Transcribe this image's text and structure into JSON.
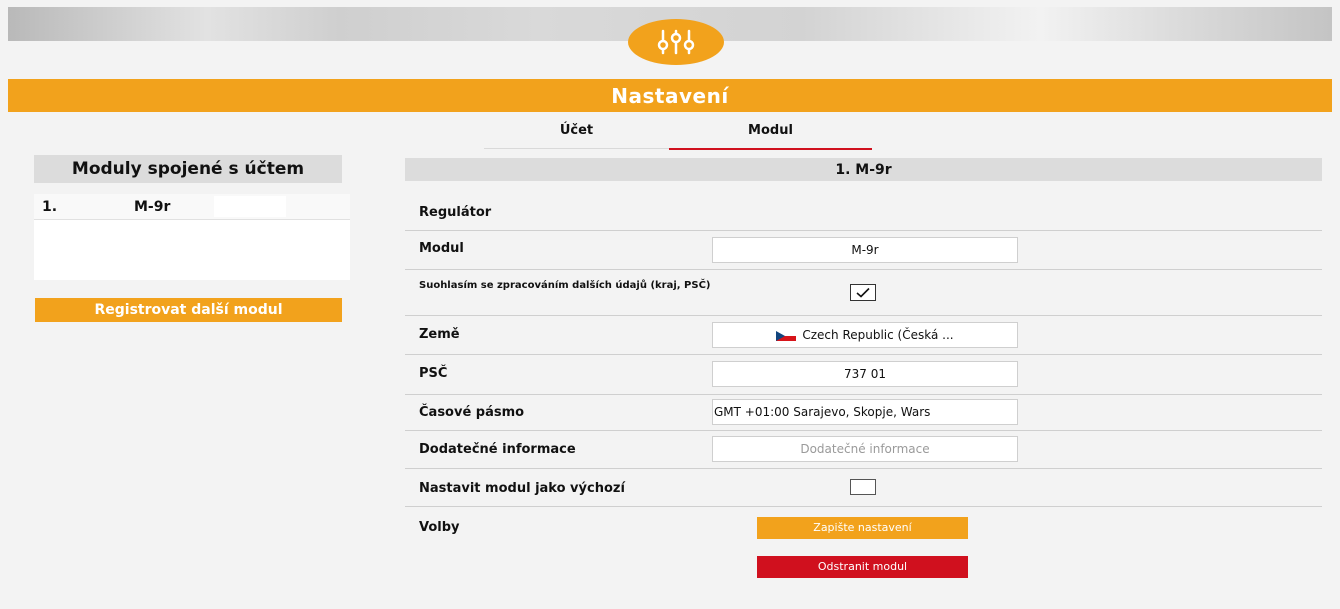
{
  "header": {
    "title": "Nastavení",
    "logo_icon": "settings-sliders-icon"
  },
  "tabs": [
    {
      "label": "Účet",
      "active": false
    },
    {
      "label": "Modul",
      "active": true
    }
  ],
  "sidebar": {
    "title": "Moduly spojené s účtem",
    "modules": [
      {
        "index": "1.",
        "name": "M-9r"
      }
    ],
    "register_button": "Registrovat další modul"
  },
  "module": {
    "header": "1. M-9r",
    "regulator_label": "Regulátor",
    "module_label": "Modul",
    "module_value": "M-9r",
    "consent_label": "Suohlasím se zpracováním dalších údajů (kraj, PSČ)",
    "consent_checked": true,
    "country_label": "Země",
    "country_value": "Czech Republic (Česká ...",
    "country_flag_icon": "czech-flag-icon",
    "zip_label": "PSČ",
    "zip_value": "737 01",
    "timezone_label": "Časové pásmo",
    "timezone_value": "GMT +01:00 Sarajevo, Skopje, Wars",
    "extra_label": "Dodatečné informace",
    "extra_placeholder": "Dodatečné informace",
    "default_label": "Nastavit modul jako výchozí",
    "default_checked": false,
    "options_label": "Volby",
    "save_button": "Zapište nastavení",
    "delete_button": "Odstranit modul"
  },
  "colors": {
    "accent": "#f2a21c",
    "danger": "#d0101e",
    "active_tab_underline": "#d0101e"
  }
}
